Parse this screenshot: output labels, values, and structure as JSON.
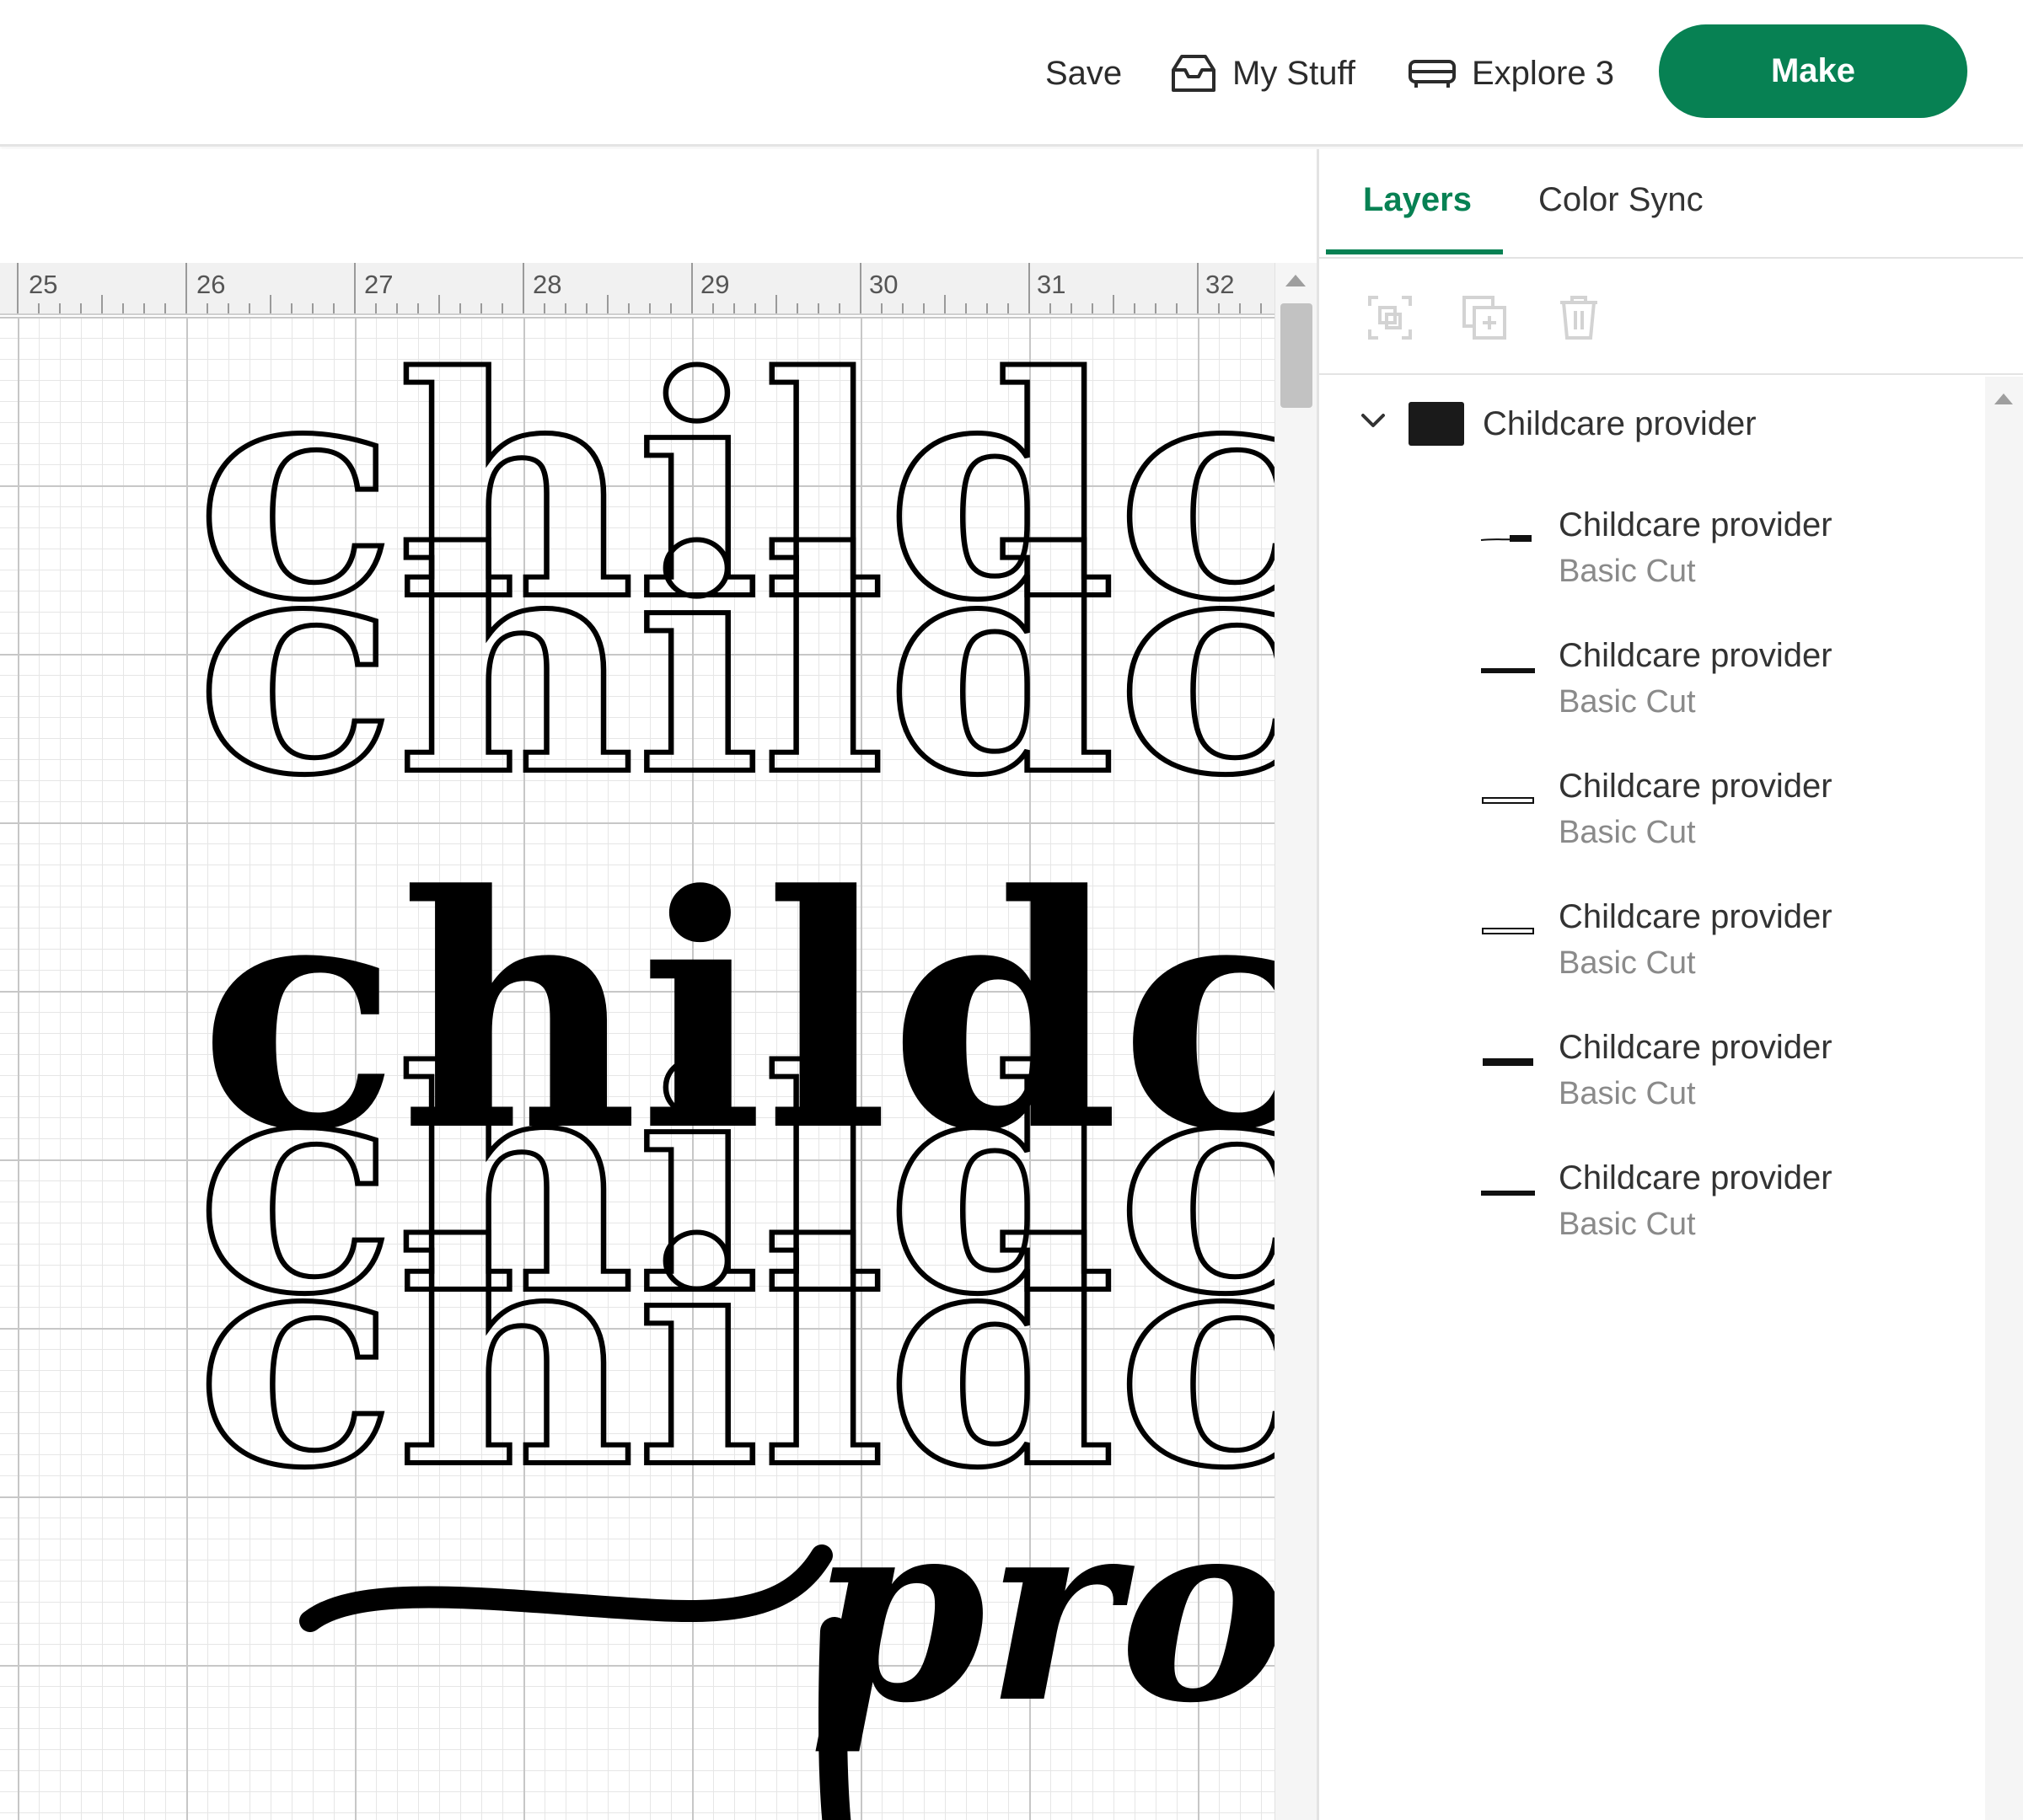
{
  "header": {
    "save_label": "Save",
    "my_stuff_label": "My Stuff",
    "machine_label": "Explore 3",
    "make_label": "Make"
  },
  "colors": {
    "brand_green": "#078153",
    "text_dark": "#333333",
    "text_muted": "#8a8a8a"
  },
  "ruler": {
    "labels": [
      "25",
      "26",
      "27",
      "28",
      "29",
      "30",
      "31",
      "32"
    ]
  },
  "canvas": {
    "stack_text": "childc",
    "script_text": "prov"
  },
  "panel": {
    "tabs": [
      {
        "label": "Layers",
        "active": true
      },
      {
        "label": "Color Sync",
        "active": false
      }
    ],
    "tools": [
      "group-icon",
      "duplicate-icon",
      "delete-icon"
    ],
    "group": {
      "label": "Childcare provider",
      "expanded": true
    },
    "layers": [
      {
        "name": "Childcare provider",
        "type": "Basic Cut"
      },
      {
        "name": "Childcare provider",
        "type": "Basic Cut"
      },
      {
        "name": "Childcare provider",
        "type": "Basic Cut"
      },
      {
        "name": "Childcare provider",
        "type": "Basic Cut"
      },
      {
        "name": "Childcare provider",
        "type": "Basic Cut"
      },
      {
        "name": "Childcare provider",
        "type": "Basic Cut"
      }
    ]
  }
}
